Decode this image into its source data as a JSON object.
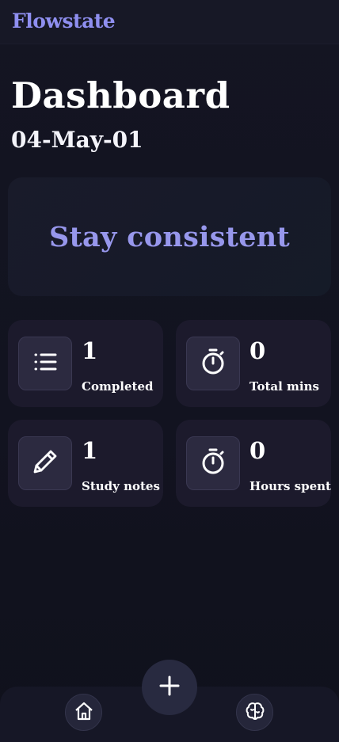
{
  "app": {
    "brand": "Flowstate"
  },
  "header": {
    "title": "Dashboard",
    "date": "04-May-01"
  },
  "quote": {
    "text": "Stay consistent"
  },
  "stats": [
    {
      "value": "1",
      "label": "Completed",
      "icon": "list-icon"
    },
    {
      "value": "0",
      "label": "Total mins",
      "icon": "stopwatch-icon"
    },
    {
      "value": "1",
      "label": "Study notes",
      "icon": "pencil-icon"
    },
    {
      "value": "0",
      "label": "Hours spent",
      "icon": "stopwatch-icon"
    }
  ],
  "nav": {
    "items": [
      {
        "icon": "home-icon"
      },
      {
        "icon": "brain-icon"
      }
    ],
    "fab_icon": "plus-icon"
  },
  "colors": {
    "accent": "#8f8ff0",
    "quote": "#9797ec",
    "background": "#12131f",
    "card": "#1c1a2c"
  }
}
